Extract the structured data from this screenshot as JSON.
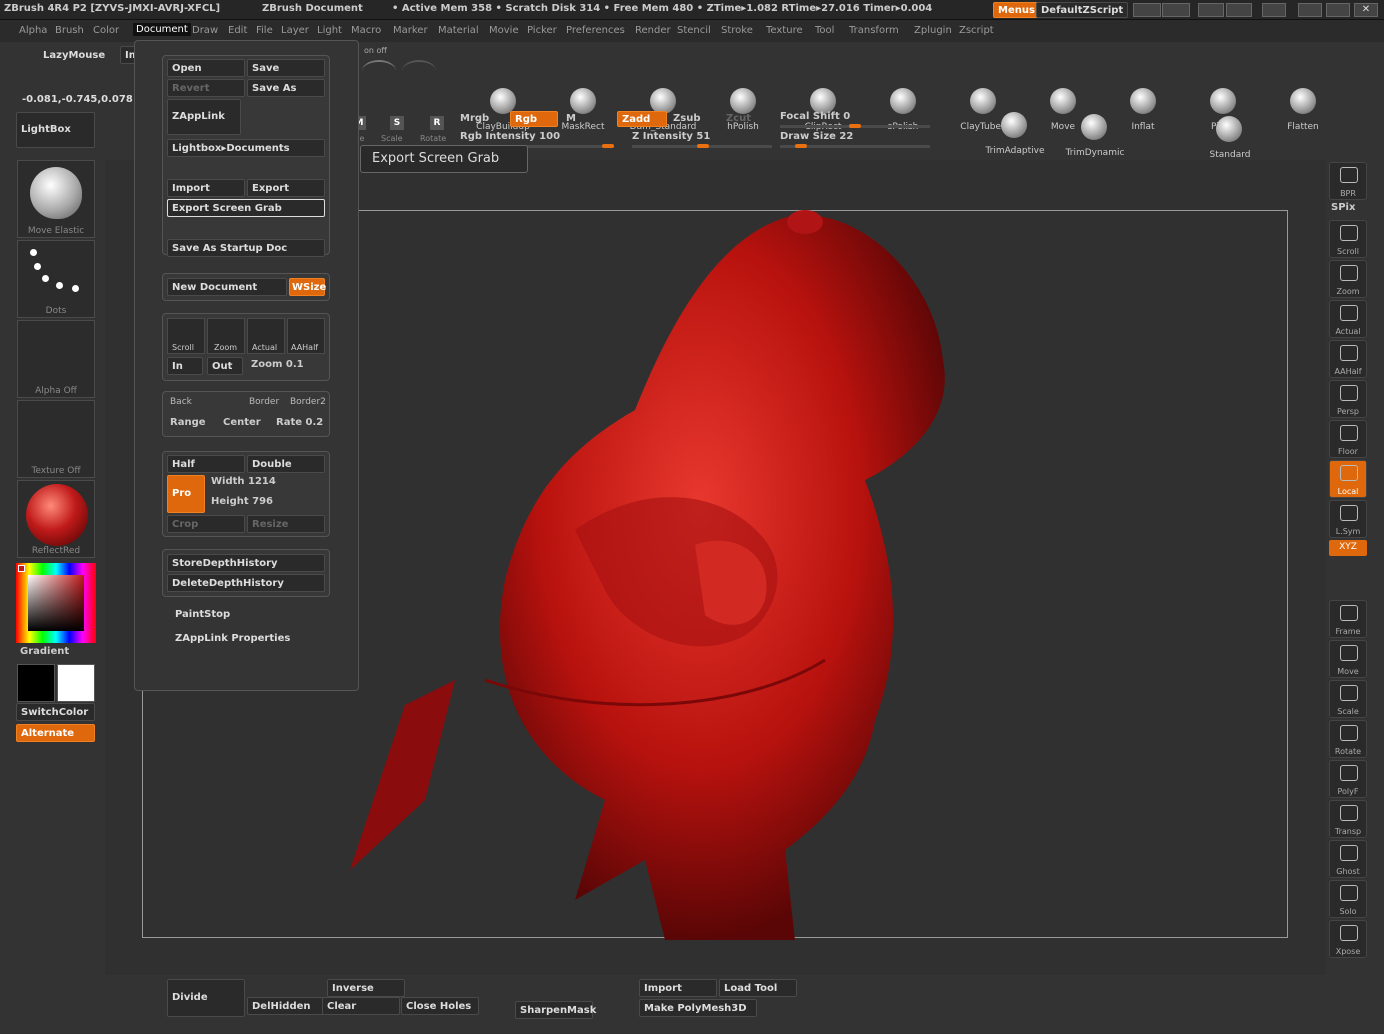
{
  "titlebar": {
    "app": "ZBrush 4R4 P2 [ZYVS-JMXI-AVRJ-XFCL]",
    "doc": "ZBrush Document",
    "stats": "• Active Mem 358 • Scratch Disk 314 • Free Mem 480 • ZTime▸1.082 RTime▸27.016 Timer▸0.004",
    "menus_btn": "Menus",
    "script": "DefaultZScript"
  },
  "menubar": [
    "Alpha",
    "Brush",
    "Color",
    "Document",
    "Draw",
    "Edit",
    "File",
    "Layer",
    "Light",
    "Macro",
    "Marker",
    "Material",
    "Movie",
    "Picker",
    "Preferences",
    "Render",
    "Stencil",
    "Stroke",
    "Texture",
    "Tool",
    "Transform",
    "Zplugin",
    "Zscript"
  ],
  "top": {
    "lazymouse": "LazyMouse",
    "import_label": "Import",
    "coords": "-0.081,-0.745,0.078",
    "lightbox": "LightBox",
    "onoff": "on  off",
    "brushes": [
      "ClayBuildup",
      "MaskRect",
      "Dam_Standard",
      "hPolish",
      "ClipRect",
      "sPolish",
      "ClayTubes",
      "Move",
      "Inflat",
      "Pinch",
      "Flatten"
    ],
    "transform": {
      "move": "Move",
      "scale": "Scale",
      "rotate": "Rotate",
      "m": "M",
      "s": "S",
      "r": "R"
    },
    "mrgb": "Mrgb",
    "rgb": "Rgb",
    "m": "M",
    "zadd": "Zadd",
    "zsub": "Zsub",
    "zcut": "Zcut",
    "rgb_intensity": "Rgb Intensity 100",
    "z_intensity": "Z Intensity 51",
    "focal_shift": "Focal Shift 0",
    "draw_size": "Draw Size 22",
    "trim_adaptive": "TrimAdaptive",
    "trim_dynamic": "TrimDynamic",
    "standard": "Standard",
    "rgb_intensity_value": 100,
    "z_intensity_value": 51,
    "focal_shift_value": 0,
    "draw_size_value": 22
  },
  "left": {
    "move_elastic": "Move Elastic",
    "dots": "Dots",
    "alpha_off": "Alpha Off",
    "texture_off": "Texture Off",
    "reflected": "ReflectRed",
    "gradient": "Gradient",
    "switchcolor": "SwitchColor",
    "alternate": "Alternate"
  },
  "tooltip": "Export Screen Grab",
  "document_menu": {
    "open": "Open",
    "save": "Save",
    "revert": "Revert",
    "save_as": "Save As",
    "zapplink": "ZAppLink",
    "lightbox_docs": "Lightbox▸Documents",
    "import": "Import",
    "export": "Export",
    "export_screen_grab": "Export Screen Grab",
    "save_startup": "Save As Startup Doc",
    "new_document": "New Document",
    "wsize": "WSize",
    "scroll": "Scroll",
    "zoom": "Zoom",
    "actual": "Actual",
    "aahalf": "AAHalf",
    "in": "In",
    "out": "Out",
    "zoom_val": "Zoom 0.1",
    "back": "Back",
    "border": "Border",
    "border2": "Border2",
    "range": "Range",
    "center": "Center",
    "rate": "Rate 0.2",
    "half": "Half",
    "double": "Double",
    "pro": "Pro",
    "width": "Width 1214",
    "height": "Height 796",
    "crop": "Crop",
    "resize": "Resize",
    "store_depth": "StoreDepthHistory",
    "delete_depth": "DeleteDepthHistory",
    "paintstop": "PaintStop",
    "zapplink_props": "ZAppLink Properties"
  },
  "right": [
    "BPR",
    "SPix",
    "Scroll",
    "Zoom",
    "Actual",
    "AAHalf",
    "Persp",
    "Floor",
    "Local",
    "L.Sym",
    "XYZ",
    "Frame",
    "Move",
    "Scale",
    "Rotate",
    "PolyF",
    "Transp",
    "Ghost",
    "Solo",
    "Xpose"
  ],
  "bottom": {
    "divide": "Divide",
    "inverse": "Inverse",
    "delhidden": "DelHidden",
    "clear": "Clear",
    "close_holes": "Close Holes",
    "sharpenmask": "SharpenMask",
    "import": "Import",
    "load_tool": "Load Tool",
    "make_polymesh": "Make PolyMesh3D"
  },
  "colors": {
    "accent": "#e0680c",
    "model": "#c01a1a",
    "primary": "#000000",
    "secondary": "#ffffff"
  }
}
